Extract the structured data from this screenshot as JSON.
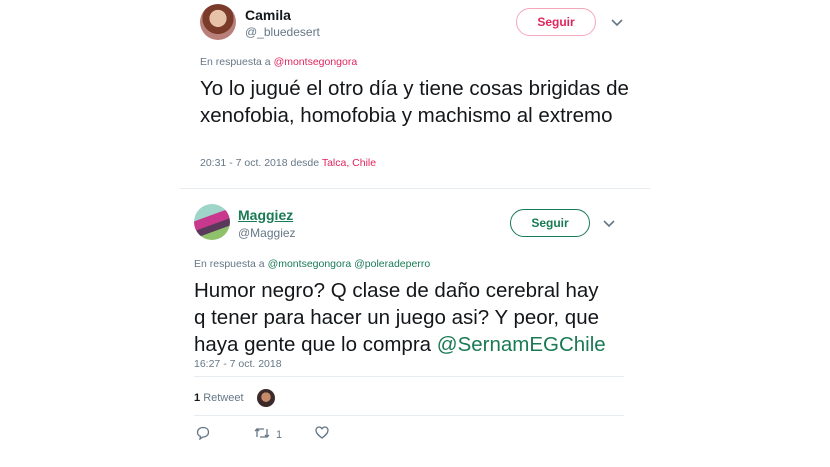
{
  "tweet1": {
    "display_name": "Camila",
    "handle": "@_bluedesert",
    "follow_label": "Seguir",
    "reply_prefix": "En respuesta a",
    "reply_mention": "@montsegongora",
    "text": "Yo lo jugué el otro día y tiene cosas brigidas de xenofobia, homofobia y machismo al extremo",
    "timestamp": "20:31 - 7 oct. 2018 desde",
    "location": "Talca, Chile",
    "accent": "#e0245e"
  },
  "tweet2": {
    "display_name": "Maggiez",
    "handle": "@Maggiez",
    "follow_label": "Seguir",
    "reply_prefix": "En respuesta a",
    "reply_mentions": [
      "@montsegongora",
      "@poleradeperro"
    ],
    "text": "Humor  negro? Q clase de daño cerebral hay q tener para hacer un juego asi? Y peor, que haya gente que lo compra",
    "text_mention": "@SernamEGChile",
    "timestamp": "16:27 - 7 oct. 2018",
    "retweet_count": "1",
    "retweet_label": "Retweet",
    "action_retweet_count": "1",
    "accent": "#1a7a55"
  },
  "icons": {
    "chevron": "chevron-down-icon",
    "reply": "reply-icon",
    "retweet": "retweet-icon",
    "like": "heart-icon"
  }
}
